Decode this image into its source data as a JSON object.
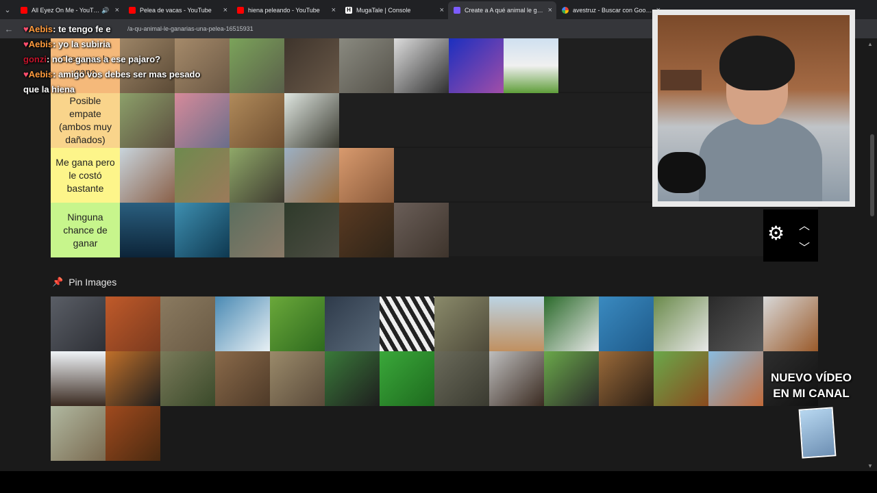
{
  "tabs": [
    {
      "title": "All Eyez On Me - YouTube",
      "fav": "yt",
      "extra": "🔊"
    },
    {
      "title": "Pelea de vacas - YouTube",
      "fav": "yt"
    },
    {
      "title": "hiena peleando - YouTube",
      "fav": "yt"
    },
    {
      "title": "MugaTale | Console",
      "fav": "hm",
      "icon_text": "H"
    },
    {
      "title": "Create a A qué animal le ganarías",
      "fav": "cr",
      "active": true
    },
    {
      "title": "avestruz - Buscar con Google",
      "fav": "gg"
    }
  ],
  "address": {
    "url": "/a-qu-animal-le-ganarias-una-pelea-16515931"
  },
  "tiers": [
    {
      "label": "Creo que le gano",
      "color": "#f5b97a",
      "images": [
        {
          "name": "hyena",
          "bg": "linear-gradient(135deg,#9c8466,#5b4a36)"
        },
        {
          "name": "hyena-2",
          "bg": "linear-gradient(135deg,#a58a6a,#6b5844)"
        },
        {
          "name": "tortoise",
          "bg": "linear-gradient(135deg,#7ba35a,#5a5f4a)"
        },
        {
          "name": "wild-boar",
          "bg": "linear-gradient(135deg,#3e342c,#6a5948)"
        },
        {
          "name": "hippo-small",
          "bg": "linear-gradient(135deg,#8a8a80,#55524a)"
        },
        {
          "name": "crow",
          "bg": "linear-gradient(135deg,#dcdcdc,#303030)"
        },
        {
          "name": "octopus",
          "bg": "linear-gradient(135deg,#1b2fbf,#a24ea8)"
        },
        {
          "name": "cow",
          "bg": "linear-gradient(180deg,#cfe0f0 0%,#f0f0f0 50%,#5f9e3a 100%)"
        }
      ]
    },
    {
      "label": "Posible empate (ambos muy dañados)",
      "color": "#f9d48b",
      "images": [
        {
          "name": "emu",
          "bg": "linear-gradient(135deg,#8ca06a,#5b4d3e)"
        },
        {
          "name": "ostrich",
          "bg": "linear-gradient(135deg,#d68a9a,#6a6e8a)"
        },
        {
          "name": "python",
          "bg": "linear-gradient(135deg,#b08a5a,#6e4e30)"
        },
        {
          "name": "anteater",
          "bg": "linear-gradient(135deg,#dfe6e0,#3a3a30)"
        }
      ]
    },
    {
      "label": "Me gana pero le costó bastante",
      "color": "#fdf58a",
      "images": [
        {
          "name": "walrus",
          "bg": "linear-gradient(135deg,#c8d4dc,#8a6048)"
        },
        {
          "name": "kangaroo",
          "bg": "linear-gradient(135deg,#6e8a4e,#9c7a5a)"
        },
        {
          "name": "buffalo",
          "bg": "linear-gradient(135deg,#8fa868,#3e3a30)"
        },
        {
          "name": "deer",
          "bg": "linear-gradient(135deg,#9bb0c4,#9a6a3a)"
        },
        {
          "name": "pitbull",
          "bg": "linear-gradient(135deg,#d89a6e,#8a5a3a)"
        }
      ]
    },
    {
      "label": "Ninguna chance de ganar",
      "color": "#c7f58c",
      "images": [
        {
          "name": "killer-whale",
          "bg": "linear-gradient(180deg,#2a5e7e,#0c2438)"
        },
        {
          "name": "shark",
          "bg": "linear-gradient(135deg,#3e8fb0,#0e3850)"
        },
        {
          "name": "elephant",
          "bg": "linear-gradient(135deg,#5a6e5e,#8a7a68)"
        },
        {
          "name": "gorilla",
          "bg": "linear-gradient(135deg,#2e3a2a,#4e4e44)"
        },
        {
          "name": "bear",
          "bg": "linear-gradient(135deg,#5a3a22,#2e2418)"
        },
        {
          "name": "hippo",
          "bg": "linear-gradient(135deg,#6a5e58,#3e342c)"
        }
      ]
    }
  ],
  "controls": {
    "gear": "gear-icon",
    "up": "chevron-up-icon",
    "down": "chevron-down-icon"
  },
  "pin": {
    "icon": "📌",
    "title": "Pin Images"
  },
  "pool": [
    {
      "name": "rhino",
      "bg": "linear-gradient(135deg,#5a5e66,#2e3036)"
    },
    {
      "name": "orangutan",
      "bg": "linear-gradient(135deg,#c05a2a,#7a3a1e)"
    },
    {
      "name": "seal",
      "bg": "linear-gradient(135deg,#8a7a60,#6a5a44)"
    },
    {
      "name": "polar-bear",
      "bg": "linear-gradient(135deg,#4a8ab4,#e8f0f4)"
    },
    {
      "name": "parrot",
      "bg": "linear-gradient(135deg,#6aa83a,#2e6a1e)"
    },
    {
      "name": "flamingo",
      "bg": "linear-gradient(135deg,#2e3a4a,#5a6a7a)"
    },
    {
      "name": "zebra",
      "bg": "repeating-linear-gradient(60deg,#eee 0 6px,#222 6px 12px)"
    },
    {
      "name": "owl",
      "bg": "linear-gradient(135deg,#8a8a6a,#4e4a3a)"
    },
    {
      "name": "giraffe",
      "bg": "linear-gradient(180deg,#bcd4e4,#c09060)"
    },
    {
      "name": "panda",
      "bg": "linear-gradient(135deg,#2a6a2a,#e8e8e8)"
    },
    {
      "name": "dolphin",
      "bg": "linear-gradient(135deg,#3a8ac0,#1e5a8a)"
    },
    {
      "name": "rabbit",
      "bg": "linear-gradient(135deg,#6a8a4a,#e8e8e8)"
    },
    {
      "name": "wolf",
      "bg": "linear-gradient(135deg,#2a2a2a,#5a5a5a)"
    },
    {
      "name": "horse",
      "bg": "linear-gradient(135deg,#d8d8d8,#9a5a2a)"
    },
    {
      "name": "eagle",
      "bg": "linear-gradient(180deg,#f0f4f8,#3a2a20)"
    },
    {
      "name": "tiger",
      "bg": "linear-gradient(135deg,#c0702a,#1e1e1e)"
    },
    {
      "name": "crocodile",
      "bg": "linear-gradient(135deg,#7a7a5a,#3a4a2a)"
    },
    {
      "name": "lion-family",
      "bg": "linear-gradient(135deg,#8a6a4a,#4e3a28)"
    },
    {
      "name": "porcupine",
      "bg": "linear-gradient(135deg,#9a8a6a,#5a4a3a)"
    },
    {
      "name": "toucan",
      "bg": "linear-gradient(135deg,#3a7a3a,#1e1e1e)"
    },
    {
      "name": "frog",
      "bg": "linear-gradient(135deg,#3aa83a,#1e6a1e)"
    },
    {
      "name": "komodo",
      "bg": "linear-gradient(135deg,#6a6a5a,#3a3a30)"
    },
    {
      "name": "tarantula",
      "bg": "linear-gradient(135deg,#bdbdbd,#3a2a20)"
    },
    {
      "name": "magpie",
      "bg": "linear-gradient(135deg,#6aa84a,#2a2a2a)"
    },
    {
      "name": "lion",
      "bg": "linear-gradient(135deg,#9a6a3a,#2a1e14)"
    },
    {
      "name": "bull",
      "bg": "linear-gradient(135deg,#6aa84a,#8a4a1e)"
    },
    {
      "name": "bat",
      "bg": "linear-gradient(135deg,#8abce0,#c06a3a)"
    },
    {
      "name": "panther",
      "bg": "linear-gradient(135deg,#2e2e2e,#111)"
    },
    {
      "name": "cougar",
      "bg": "linear-gradient(135deg,#b0b8a0,#7a6a50)"
    },
    {
      "name": "orangutan-2",
      "bg": "linear-gradient(135deg,#a04a1e,#4a2a10)"
    }
  ],
  "chat": [
    {
      "user": "Aebis",
      "heart": true,
      "cls": "u1",
      "text": ": te tengo fe e"
    },
    {
      "user": "Aebis",
      "heart": true,
      "cls": "u1",
      "text": ": yo la subiria"
    },
    {
      "user": "gonzi",
      "heart": false,
      "cls": "u2",
      "text": ": no le ganas a ese pajaro?"
    },
    {
      "user": "Aebis",
      "heart": true,
      "cls": "u1",
      "text": ": amigo vos debes ser mas pesado que la hiena"
    }
  ],
  "promo": {
    "line1": "NUEVO VÍDEO",
    "line2": "EN MI CANAL"
  }
}
